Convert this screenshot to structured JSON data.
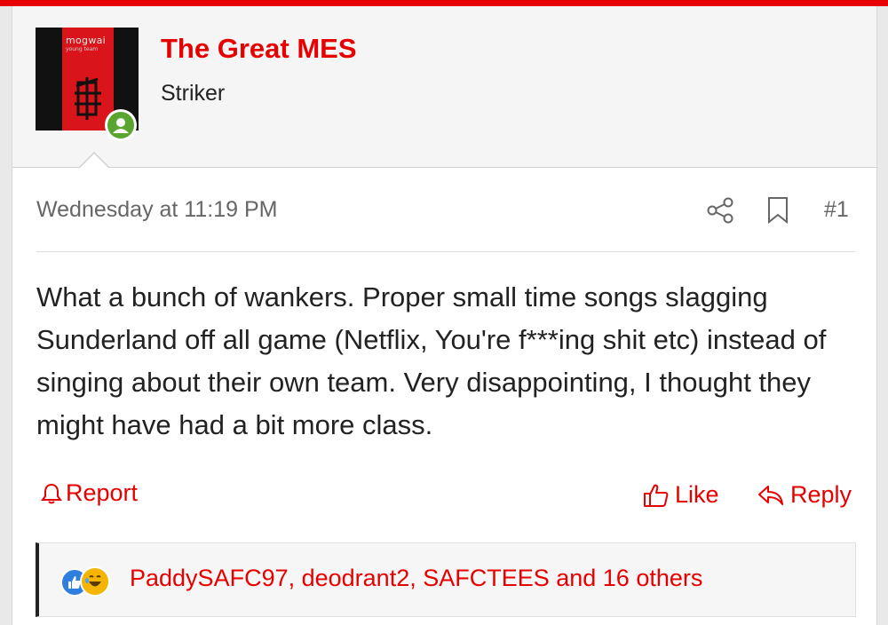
{
  "user": {
    "name": "The Great MES",
    "title": "Striker",
    "avatar": {
      "text_line1": "mogwai",
      "text_line2": "young team",
      "bg": "#111111",
      "accent": "#d9141b"
    },
    "online_color": "#5aa52f"
  },
  "post": {
    "date": "Wednesday at 11:19 PM",
    "number": "#1",
    "body": "What a bunch of wankers. Proper small time songs slagging Sunderland off all game (Netflix, You're f***ing shit etc) instead of singing about their own team. Very disappointing, I thought they might have had a bit more class."
  },
  "actions": {
    "report_label": "Report",
    "like_label": "Like",
    "reply_label": "Reply"
  },
  "reactions": {
    "icons": [
      "like-icon",
      "laugh-icon"
    ],
    "users_text": "PaddySAFC97, deodrant2, SAFCTEES and 16 others"
  },
  "colors": {
    "accent": "#e60000",
    "muted": "#666666"
  }
}
